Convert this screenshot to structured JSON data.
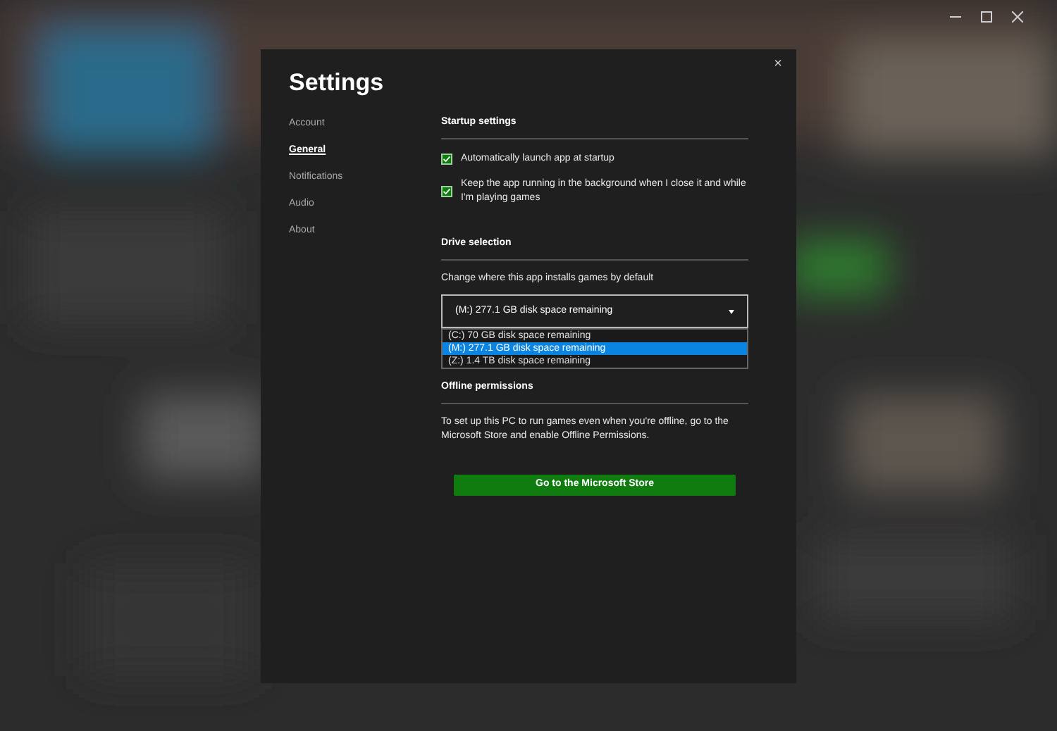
{
  "dialog": {
    "title": "Settings",
    "close": "×"
  },
  "sidebar": {
    "items": [
      {
        "label": "Account",
        "selected": false
      },
      {
        "label": "General",
        "selected": true
      },
      {
        "label": "Notifications",
        "selected": false
      },
      {
        "label": "Audio",
        "selected": false
      },
      {
        "label": "About",
        "selected": false
      }
    ]
  },
  "startup": {
    "heading": "Startup settings",
    "options": [
      {
        "label": "Automatically launch app at startup",
        "checked": true
      },
      {
        "label": "Keep the app running in the background when I close it and while I'm playing games",
        "checked": true
      }
    ]
  },
  "drive": {
    "heading": "Drive selection",
    "description": "Change where this app installs games by default",
    "value": "(M:) 277.1 GB disk space remaining",
    "options": [
      {
        "label": "(C:) 70 GB disk space remaining",
        "selected": false
      },
      {
        "label": "(M:) 277.1 GB disk space remaining",
        "selected": true
      },
      {
        "label": "(Z:) 1.4 TB disk space remaining",
        "selected": false
      }
    ]
  },
  "offline": {
    "heading": "Offline permissions",
    "description": "To set up this PC to run games even when you're offline, go to the Microsoft Store and enable Offline Permissions.",
    "button": "Go to the Microsoft Store"
  }
}
